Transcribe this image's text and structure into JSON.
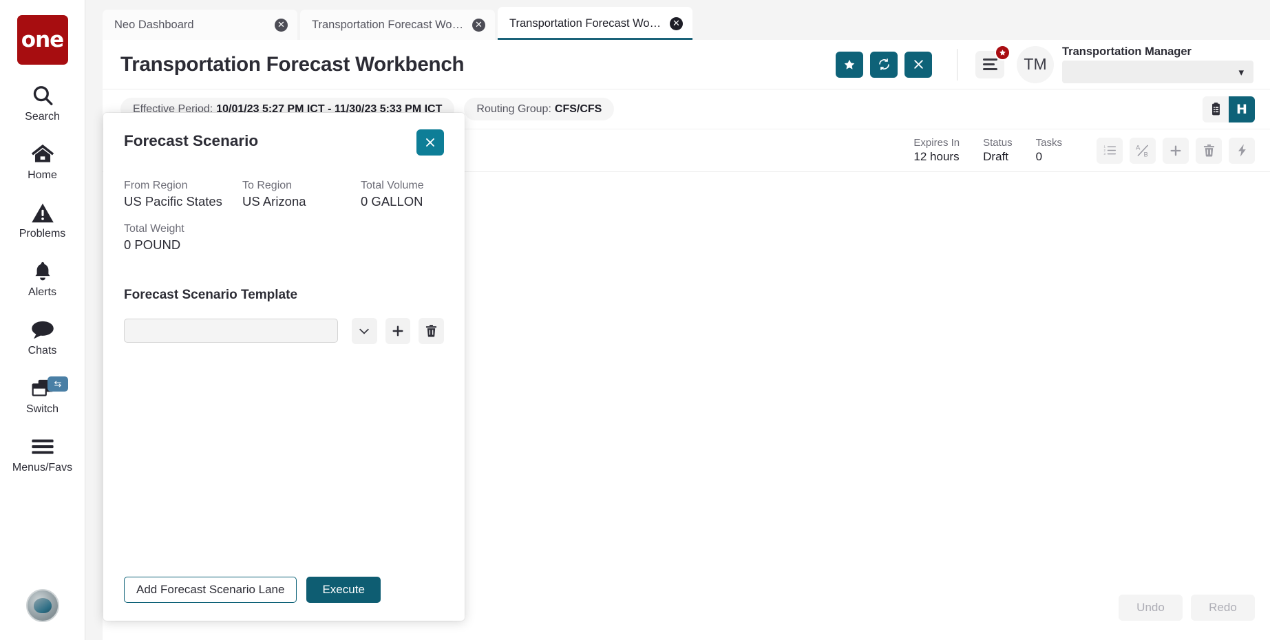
{
  "brand": {
    "logo_text": "one"
  },
  "sidebar": {
    "items": [
      {
        "label": "Search",
        "icon": "search-icon"
      },
      {
        "label": "Home",
        "icon": "home-icon"
      },
      {
        "label": "Problems",
        "icon": "warning-triangle-icon"
      },
      {
        "label": "Alerts",
        "icon": "bell-icon"
      },
      {
        "label": "Chats",
        "icon": "chat-bubble-icon"
      },
      {
        "label": "Switch",
        "icon": "windows-switch-icon",
        "badge_icon": "swap-arrows-icon"
      },
      {
        "label": "Menus/Favs",
        "icon": "hamburger-icon"
      }
    ]
  },
  "tabs": [
    {
      "label": "Neo Dashboard",
      "active": false
    },
    {
      "label": "Transportation Forecast Workbe...",
      "active": false
    },
    {
      "label": "Transportation Forecast Workbe...",
      "active": true
    }
  ],
  "header": {
    "title": "Transportation Forecast Workbench",
    "buttons": [
      {
        "name": "favorite-button",
        "icon": "star-icon"
      },
      {
        "name": "refresh-button",
        "icon": "refresh-icon"
      },
      {
        "name": "close-page-button",
        "icon": "close-x-icon"
      }
    ],
    "menu_badge": "star-badge-icon",
    "avatar_initials": "TM",
    "user_role": "Transportation Manager",
    "user_select_value": ""
  },
  "info_bar": {
    "effective_period_label": "Effective Period:",
    "effective_period_value": "10/01/23 5:27 PM ICT - 11/30/23 5:33 PM ICT",
    "routing_group_label": "Routing Group:",
    "routing_group_value": "CFS/CFS",
    "view_buttons": [
      {
        "name": "clipboard-list-view-button",
        "icon": "clipboard-list-icon",
        "active": false
      },
      {
        "name": "history-view-button",
        "icon": "letter-h-icon",
        "label": "H",
        "active": true
      }
    ]
  },
  "scenario_row": {
    "stats": [
      {
        "key": "Expires In",
        "value": "12 hours"
      },
      {
        "key": "Status",
        "value": "Draft"
      },
      {
        "key": "Tasks",
        "value": "0"
      }
    ],
    "actions": [
      {
        "name": "numbered-list-button",
        "icon": "numbered-list-icon"
      },
      {
        "name": "ab-compare-button",
        "icon": "ab-compare-icon"
      },
      {
        "name": "add-button",
        "icon": "plus-icon"
      },
      {
        "name": "delete-button",
        "icon": "trash-icon"
      },
      {
        "name": "execute-bolt-button",
        "icon": "lightning-bolt-icon"
      }
    ]
  },
  "footer": {
    "undo_label": "Undo",
    "redo_label": "Redo"
  },
  "modal": {
    "title": "Forecast Scenario",
    "close_icon": "close-x-icon",
    "meta": [
      {
        "key": "From Region",
        "value": "US Pacific States"
      },
      {
        "key": "To Region",
        "value": "US Arizona"
      },
      {
        "key": "Total Volume",
        "value": "0 GALLON"
      },
      {
        "key": "Total Weight",
        "value": "0 POUND"
      }
    ],
    "template_section_title": "Forecast Scenario Template",
    "template_input_value": "",
    "template_input_placeholder": "",
    "template_buttons": [
      {
        "name": "template-dropdown-button",
        "icon": "chevron-down-icon"
      },
      {
        "name": "template-add-button",
        "icon": "plus-icon"
      },
      {
        "name": "template-delete-button",
        "icon": "trash-icon"
      }
    ],
    "add_lane_label": "Add Forecast Scenario Lane",
    "execute_label": "Execute"
  },
  "colors": {
    "brand_red": "#a70d10",
    "teal": "#0e6278",
    "teal_light": "#0e7e97",
    "badge_red": "#a90d12"
  }
}
